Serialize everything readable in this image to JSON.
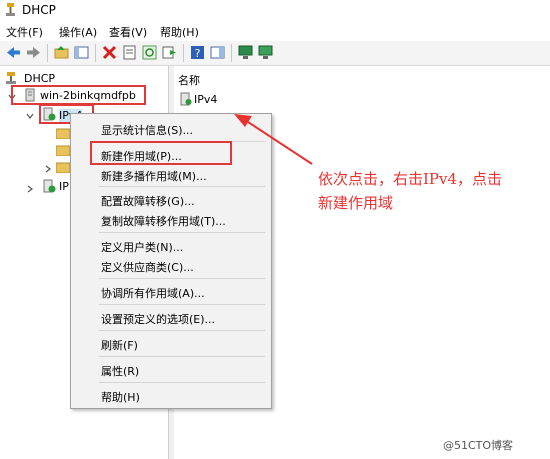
{
  "window": {
    "title": "DHCP"
  },
  "menu": [
    "文件(F)",
    "操作(A)",
    "查看(V)",
    "帮助(H)"
  ],
  "tree": {
    "root": "DHCP",
    "server": "win-2binkqmdfpb",
    "ipv4": "IPv4",
    "ipv6_partial": "IP"
  },
  "right_pane": {
    "column_header": "名称",
    "items": [
      "IPv4"
    ]
  },
  "context_menu": {
    "groups": [
      [
        "显示统计信息(S)..."
      ],
      [
        "新建作用域(P)...",
        "新建多播作用域(M)..."
      ],
      [
        "配置故障转移(G)...",
        "复制故障转移作用域(T)..."
      ],
      [
        "定义用户类(N)...",
        "定义供应商类(C)..."
      ],
      [
        "协调所有作用域(A)..."
      ],
      [
        "设置预定义的选项(E)..."
      ],
      [
        "刷新(F)"
      ],
      [
        "属性(R)"
      ],
      [
        "帮助(H)"
      ]
    ]
  },
  "annotation": {
    "line1": "依次点击，右击IPv4，点击",
    "line2": "新建作用域"
  },
  "watermark": "@51CTO博客",
  "colors": {
    "annotation_red": "#e8322f",
    "toolbar_blue": "#2e7bd1"
  }
}
